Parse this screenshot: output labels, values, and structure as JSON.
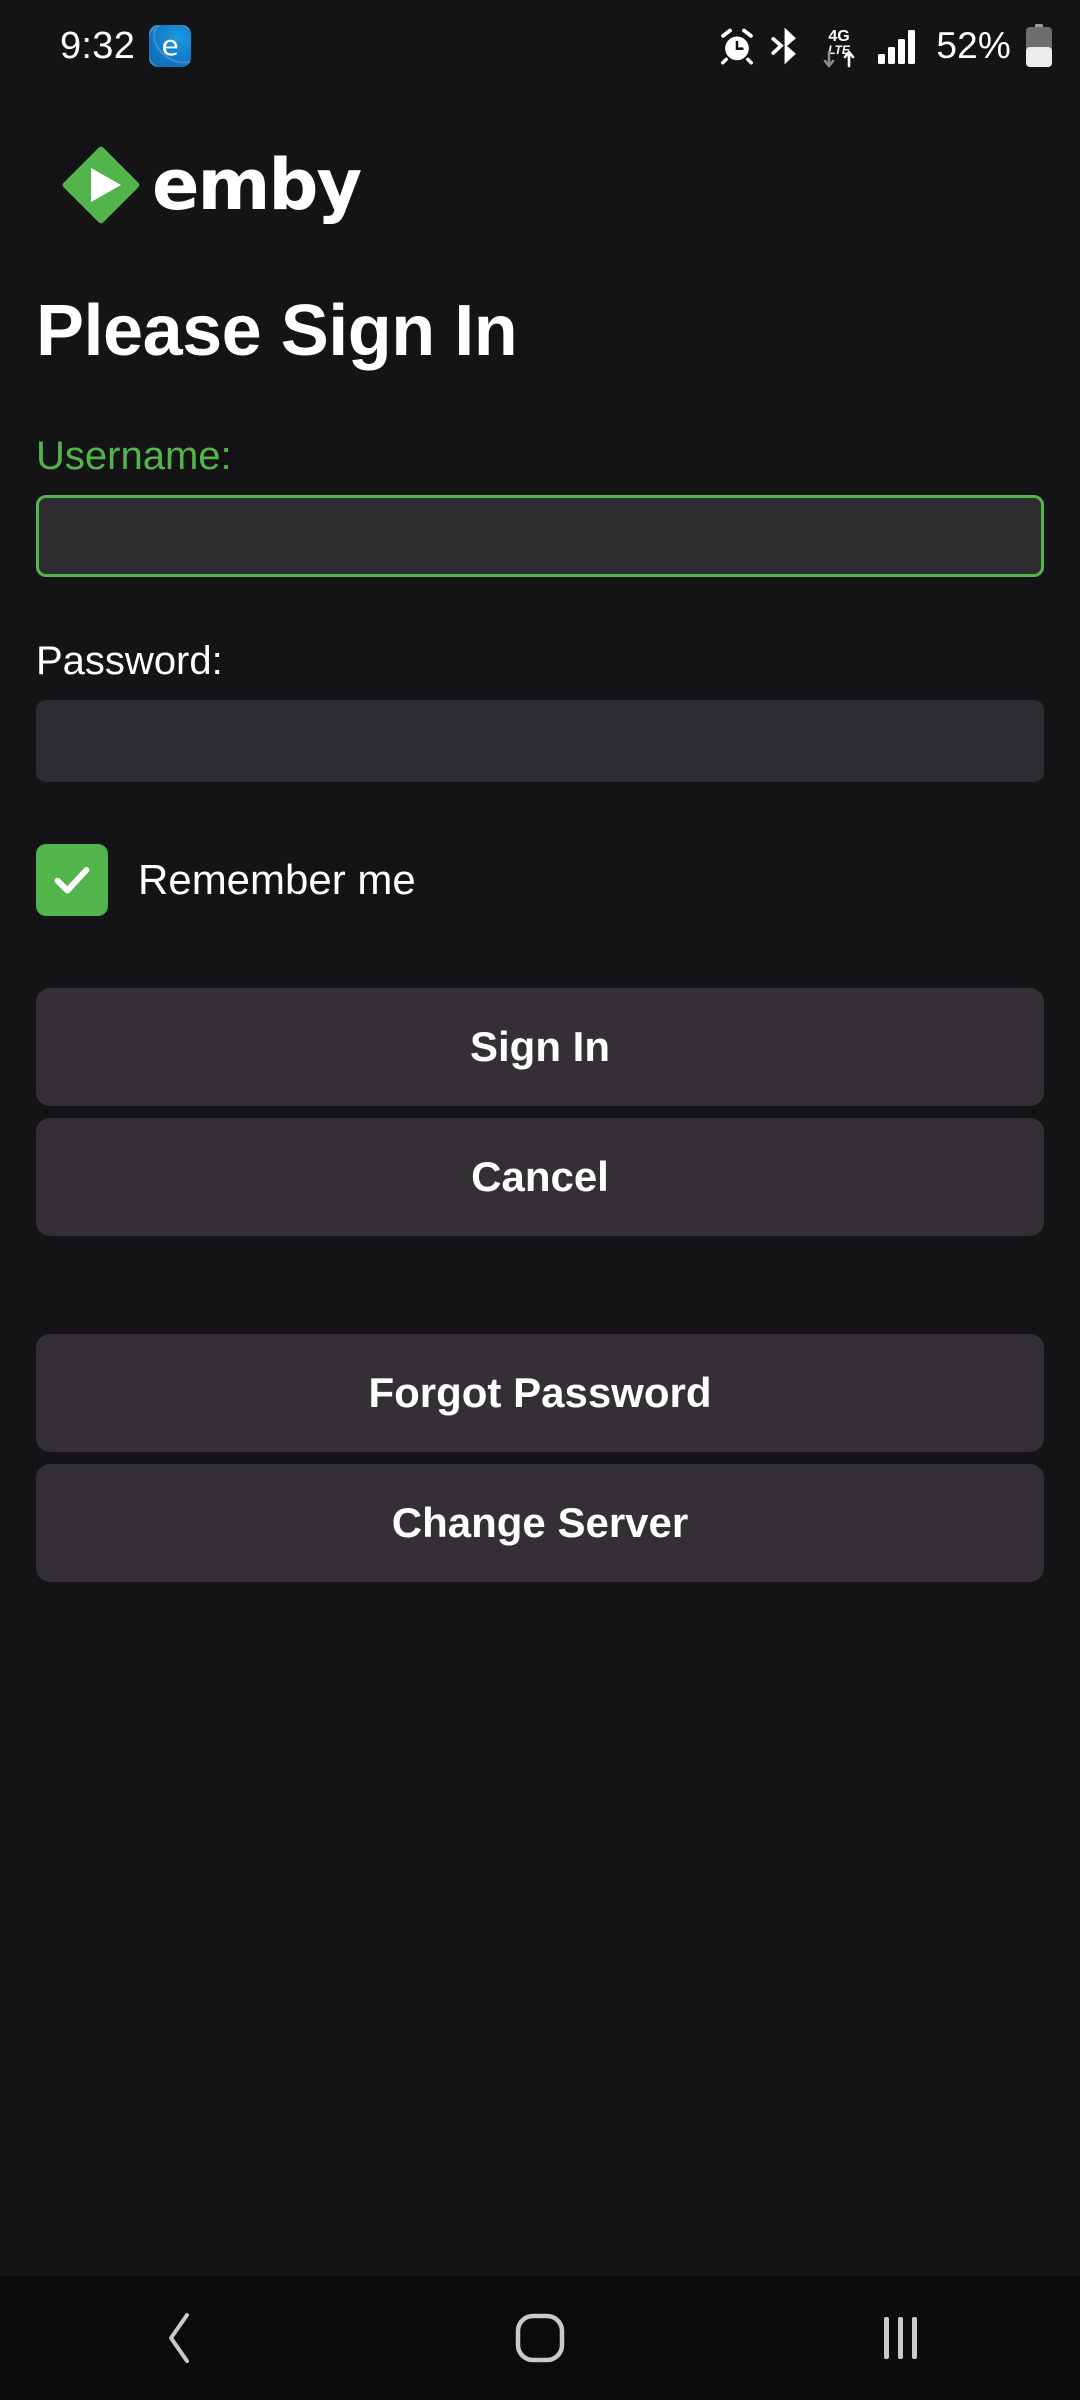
{
  "status_bar": {
    "clock": "9:32",
    "notification_icon": "edge-browser-icon",
    "notification_icon_letter": "e",
    "icons": [
      "alarm-icon",
      "bluetooth-icon",
      "4g-lte-data-icon",
      "signal-bars-icon"
    ],
    "lte_label_top": "4G",
    "lte_label_bottom": "LTE",
    "battery_percent": "52%"
  },
  "brand": {
    "logo_icon": "emby-diamond-play-logo",
    "wordmark": "emby",
    "accent_color": "#52b54b"
  },
  "page": {
    "title": "Please Sign In"
  },
  "form": {
    "username": {
      "label": "Username:",
      "value": "",
      "placeholder": "",
      "focused": true
    },
    "password": {
      "label": "Password:",
      "value": "",
      "placeholder": "",
      "focused": false
    },
    "remember_me": {
      "label": "Remember me",
      "checked": true
    }
  },
  "buttons": {
    "primary": [
      {
        "label": "Sign In",
        "name": "sign-in-button"
      },
      {
        "label": "Cancel",
        "name": "cancel-button"
      }
    ],
    "secondary": [
      {
        "label": "Forgot Password",
        "name": "forgot-password-button"
      },
      {
        "label": "Change Server",
        "name": "change-server-button"
      }
    ]
  },
  "nav_bar": {
    "back": "back-icon",
    "home": "home-icon",
    "recents": "recents-icon"
  }
}
